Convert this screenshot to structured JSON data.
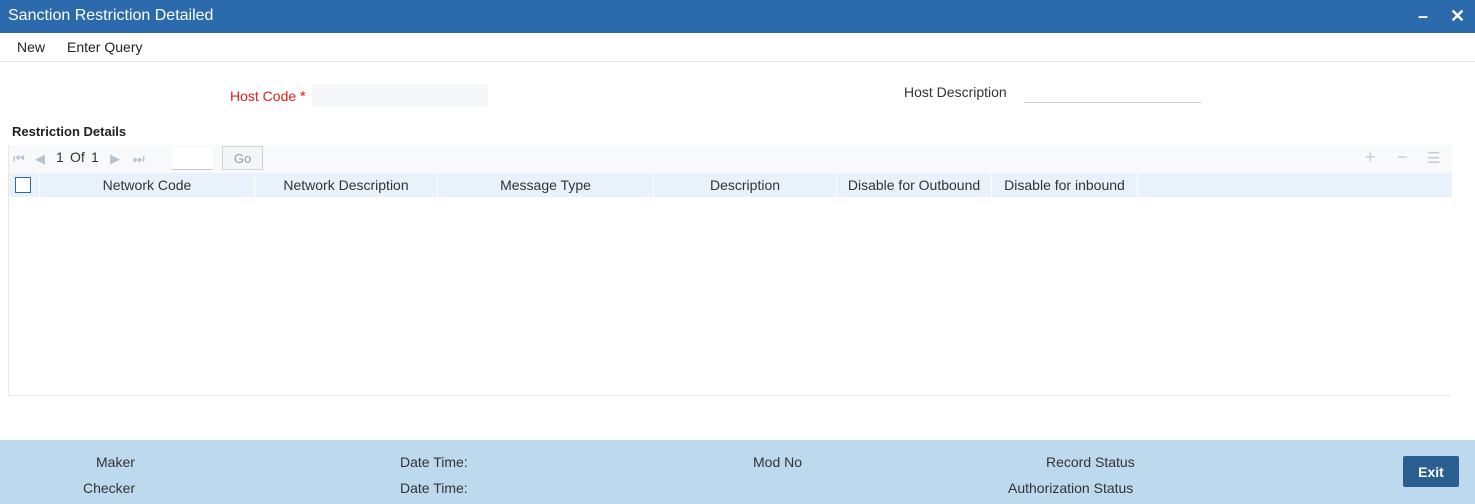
{
  "window": {
    "title": "Sanction Restriction Detailed",
    "minimize_glyph": "–",
    "close_glyph": "✕"
  },
  "toolbar": {
    "new_label": "New",
    "enter_query_label": "Enter Query"
  },
  "form": {
    "host_code_label": "Host Code",
    "required_marker": "*",
    "host_code_value": "",
    "host_description_label": "Host Description",
    "host_description_value": ""
  },
  "restriction_details": {
    "title": "Restriction Details",
    "pager": {
      "current_page": "1",
      "of_label": "Of",
      "total_pages": "1",
      "go_label": "Go"
    },
    "columns": [
      "Network Code",
      "Network Description",
      "Message Type",
      "Description",
      "Disable for Outbound",
      "Disable for inbound"
    ],
    "rows": []
  },
  "footer": {
    "maker_label": "Maker",
    "checker_label": "Checker",
    "date_time_label": "Date Time:",
    "mod_no_label": "Mod No",
    "record_status_label": "Record Status",
    "authorization_status_label": "Authorization Status",
    "exit_label": "Exit"
  },
  "colors": {
    "title_bar": "#2a6aad",
    "required": "#e0201b",
    "grid_header": "#e9f2fa",
    "footer": "#bcd9ee",
    "exit_button": "#2a5e91"
  }
}
